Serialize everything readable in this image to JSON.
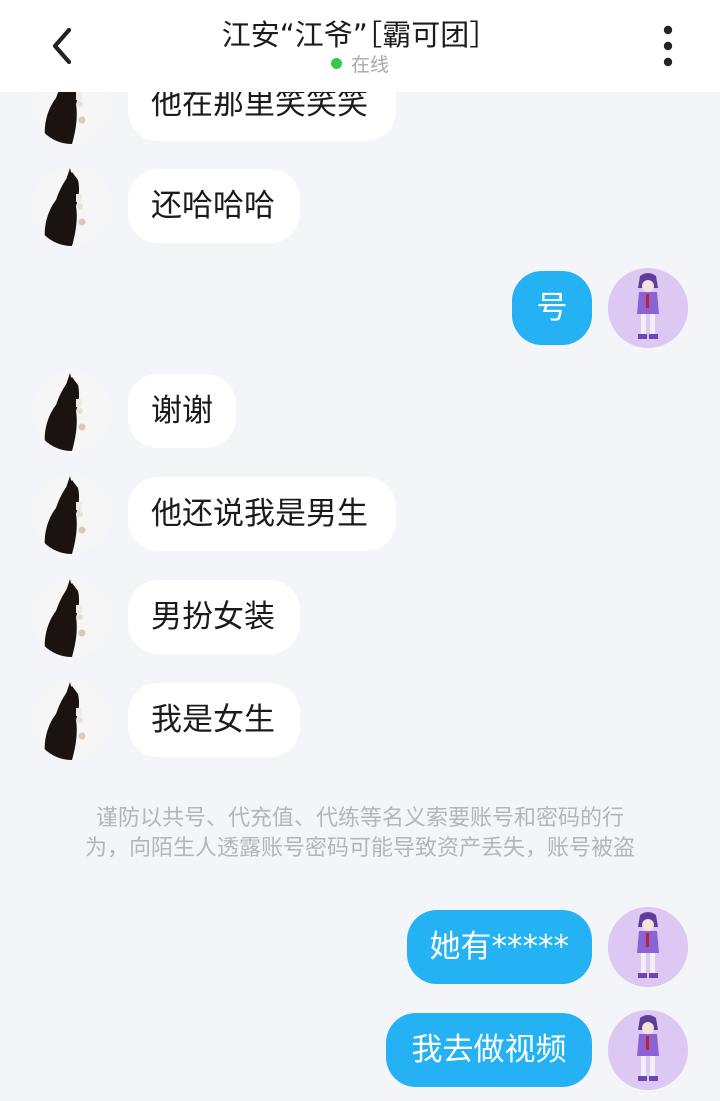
{
  "header": {
    "title": "江安“江爷”［霸可团］",
    "status": "在线",
    "back_icon": "chevron-left-icon",
    "more_icon": "more-vertical-icon"
  },
  "messages": [
    {
      "side": "in",
      "text": "他在那里笑笑笑"
    },
    {
      "side": "in",
      "text": "还哈哈哈"
    },
    {
      "side": "out",
      "text": "号"
    },
    {
      "side": "in",
      "text": "谢谢"
    },
    {
      "side": "in",
      "text": "他还说我是男生"
    },
    {
      "side": "in",
      "text": "男扮女装"
    },
    {
      "side": "in",
      "text": "我是女生"
    },
    {
      "side": "out",
      "text": "她有*****"
    },
    {
      "side": "out",
      "text": "我去做视频"
    }
  ],
  "notice": {
    "line1": "谨防以共号、代充值、代练等名义索要账号和密码的行",
    "line2": "为，向陌生人透露账号密码可能导致资产丢失，账号被盗"
  },
  "colors": {
    "background": "#f3f5f8",
    "bubble_in": "#ffffff",
    "bubble_out": "#24b2f4",
    "online_dot": "#38c84f"
  }
}
